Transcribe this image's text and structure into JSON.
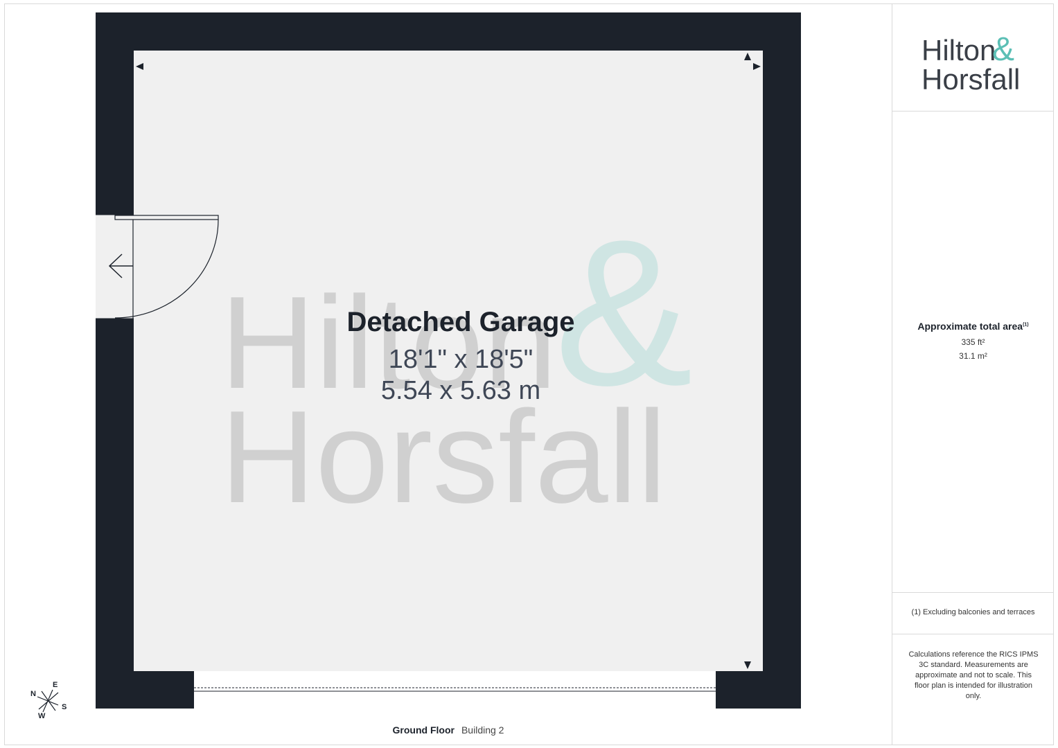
{
  "brand": {
    "line1": "Hilton",
    "ampersand": "&",
    "line2": "Horsfall",
    "accent_color": "#5bbfb5",
    "text_color": "#3a3f47"
  },
  "room": {
    "name": "Detached Garage",
    "imperial": "18'1\" x 18'5\"",
    "metric": "5.54 x 5.63 m"
  },
  "watermark": {
    "line1": "Hilton",
    "ampersand": "&",
    "line2": "Horsfall"
  },
  "area": {
    "title": "Approximate total area",
    "title_note": "(1)",
    "imperial": "335 ft²",
    "metric": "31.1 m²"
  },
  "footnote": "(1) Excluding balconies and terraces",
  "disclaimer": "Calculations reference the RICS IPMS 3C standard. Measurements are approximate and not to scale. This floor plan is intended for illustration only.",
  "caption": {
    "floor": "Ground Floor",
    "building": "Building 2"
  },
  "compass": {
    "n": "N",
    "e": "E",
    "s": "S",
    "w": "W"
  },
  "colors": {
    "wall": "#1c222b",
    "floor": "#f0f0f0"
  }
}
